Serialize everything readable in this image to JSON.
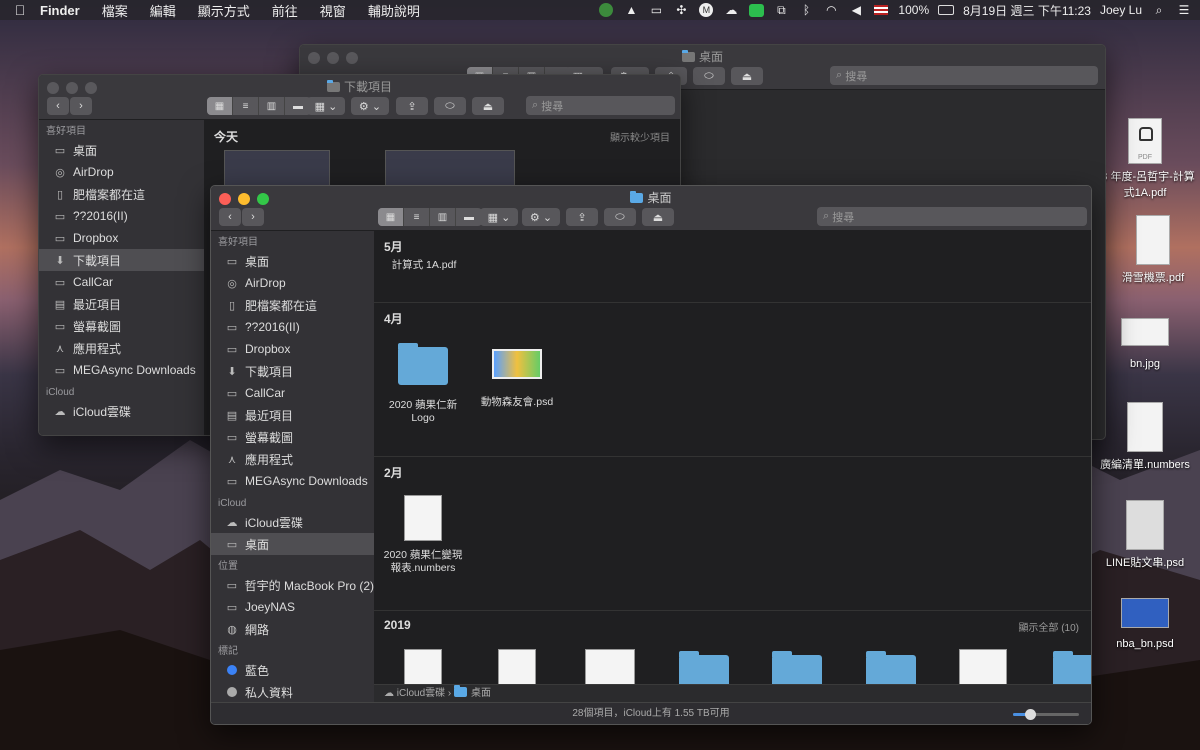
{
  "menubar": {
    "apple": "",
    "items": [
      "Finder",
      "檔案",
      "編輯",
      "顯示方式",
      "前往",
      "視窗",
      "輔助說明"
    ],
    "battery": "100%",
    "datetime": "8月19日 週三 下午11:23",
    "user": "Joey Lu"
  },
  "back_window": {
    "title": "桌面",
    "search_placeholder": "搜尋"
  },
  "mid_window": {
    "title": "下載項目",
    "search_placeholder": "搜尋",
    "sidebar_header": "喜好項目",
    "sidebar": [
      "桌面",
      "AirDrop",
      "肥檔案都在這",
      "??2016(II)",
      "Dropbox",
      "下載項目",
      "CallCar",
      "最近項目",
      "螢幕截圖",
      "應用程式",
      "MEGAsync Downloads"
    ],
    "icloud_header": "iCloud",
    "icloud_items": [
      "iCloud雲碟"
    ],
    "section_title": "今天",
    "section_action": "顯示較少項目"
  },
  "front_window": {
    "title": "桌面",
    "search_placeholder": "搜尋",
    "favorites_header": "喜好項目",
    "favorites": [
      "桌面",
      "AirDrop",
      "肥檔案都在這",
      "??2016(II)",
      "Dropbox",
      "下載項目",
      "CallCar",
      "最近項目",
      "螢幕截圖",
      "應用程式",
      "MEGAsync Downloads"
    ],
    "icloud_header": "iCloud",
    "icloud": [
      "iCloud雲碟",
      "桌面"
    ],
    "locations_header": "位置",
    "locations": [
      "哲宇的 MacBook Pro (2)",
      "JoeyNAS",
      "網路"
    ],
    "tags_header": "標記",
    "tags": [
      "藍色",
      "私人資料"
    ],
    "sections": {
      "may": {
        "title": "5月",
        "item": "計算式 1A.pdf"
      },
      "april": {
        "title": "4月",
        "items": [
          "2020 蘋果仁新 Logo",
          "動物森友會.psd"
        ]
      },
      "feb": {
        "title": "2月",
        "items": [
          "2020 蘋果仁變現 報表.numbers"
        ]
      },
      "y2019": {
        "title": "2019",
        "action": "顯示全部 (10)"
      }
    },
    "path": [
      "iCloud雲碟",
      "桌面"
    ],
    "path_sep": "›",
    "status": "28個項目，iCloud上有 1.55 TB可用"
  },
  "desktop_items": [
    "08 年度-呂哲宇-計算式1A.pdf",
    "滑雪機票.pdf",
    "bn.jpg",
    "廣編清單.numbers",
    "LINE貼文串.psd",
    "nba_bn.psd"
  ],
  "desktop_pdf_badge": "PDF"
}
